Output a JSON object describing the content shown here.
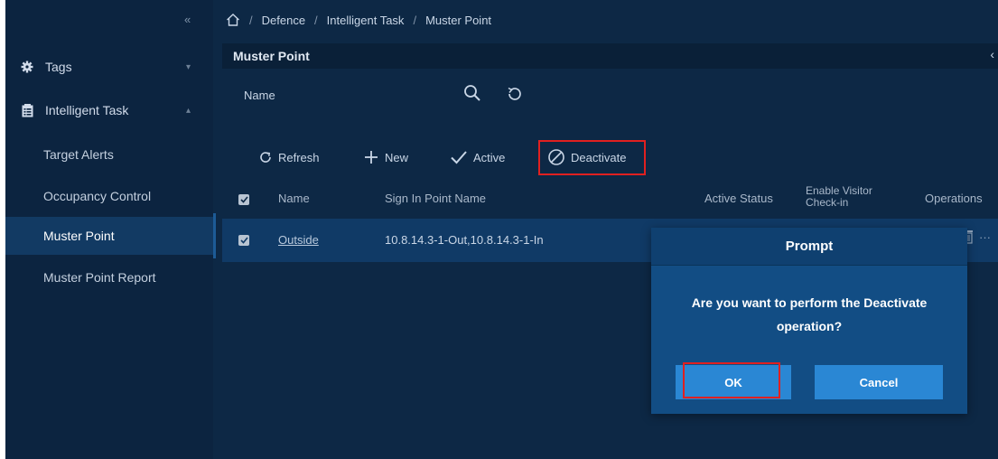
{
  "sidebar": {
    "collapse_glyph": "«",
    "groups": [
      {
        "label": "Tags",
        "icon": "gear-icon"
      },
      {
        "label": "Intelligent Task",
        "icon": "clipboard-icon"
      }
    ],
    "items": [
      {
        "label": "Target Alerts"
      },
      {
        "label": "Occupancy Control"
      },
      {
        "label": "Muster Point",
        "active": true
      },
      {
        "label": "Muster Point Report"
      }
    ]
  },
  "breadcrumb": {
    "sep": "/",
    "items": [
      "Defence",
      "Intelligent Task",
      "Muster Point"
    ]
  },
  "page": {
    "title": "Muster Point"
  },
  "filter": {
    "name_label": "Name"
  },
  "toolbar": {
    "refresh": "Refresh",
    "new": "New",
    "active": "Active",
    "deactivate": "Deactivate"
  },
  "table": {
    "headers": {
      "name": "Name",
      "sign_in": "Sign In Point Name",
      "active_status": "Active Status",
      "enable_visitor_1": "Enable Visitor",
      "enable_visitor_2": "Check-in",
      "operations": "Operations"
    },
    "rows": [
      {
        "name": "Outside",
        "sign_in": "10.8.14.3-1-Out,10.8.14.3-1-In",
        "more": "···"
      }
    ]
  },
  "dialog": {
    "title": "Prompt",
    "message_line1": "Are you want to perform the Deactivate",
    "message_line2": "operation?",
    "ok": "OK",
    "cancel": "Cancel"
  },
  "colors": {
    "background": "#0d2845",
    "sidebar": "#0c2440",
    "active_row": "#103a66",
    "dialog": "#124d84",
    "button": "#2a87d4",
    "highlight": "#e02020"
  }
}
